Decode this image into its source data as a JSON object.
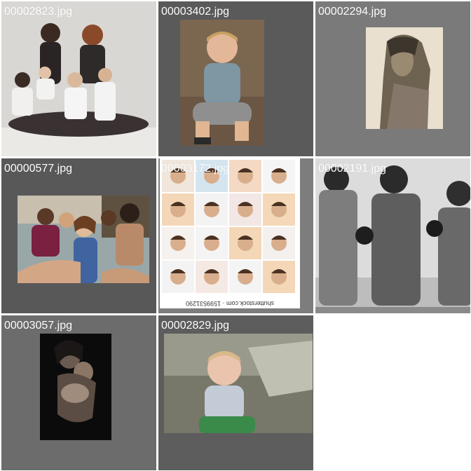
{
  "gallery": {
    "tiles": [
      {
        "filename": "00002823.jpg"
      },
      {
        "filename": "00003402.jpg"
      },
      {
        "filename": "00002294.jpg"
      },
      {
        "filename": "00000577.jpg"
      },
      {
        "filename": "00003172.jpg",
        "caption": "shutterstock.com · 1599531290"
      },
      {
        "filename": "00002191.jpg"
      },
      {
        "filename": "00003057.jpg"
      },
      {
        "filename": "00002829.jpg"
      }
    ]
  },
  "colors": {
    "label_text": "#ffffff",
    "tile_background": "#6f6f6f",
    "page_background": "#ffffff"
  }
}
